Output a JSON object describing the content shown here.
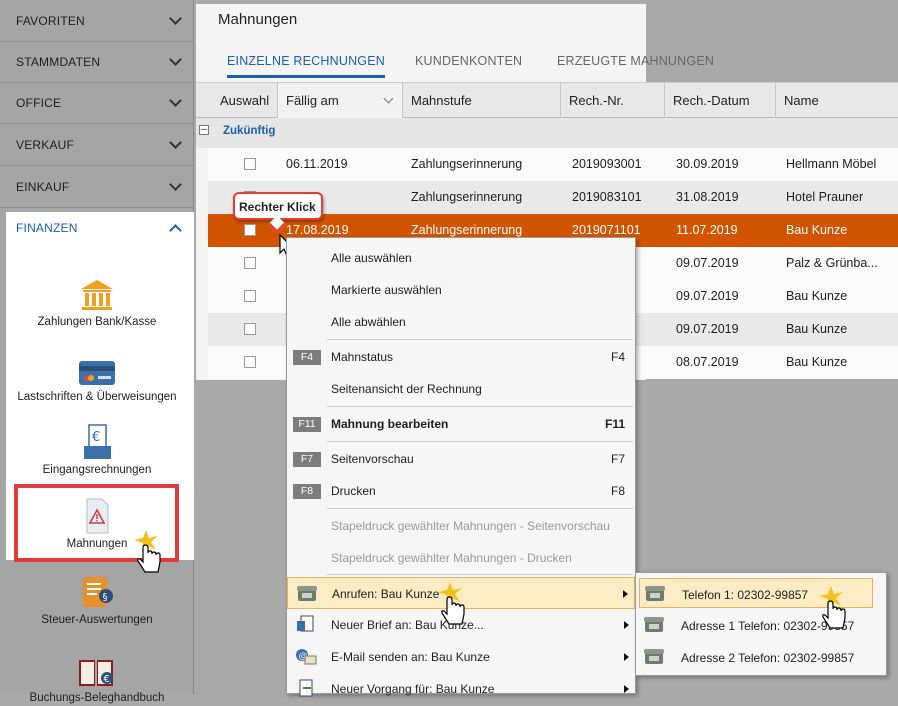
{
  "sidebar": {
    "sections": [
      "FAVORITEN",
      "STAMMDATEN",
      "OFFICE",
      "VERKAUF",
      "EINKAUF"
    ],
    "finance": {
      "title": "FINANZEN",
      "items": [
        {
          "label": "Zahlungen Bank/Kasse",
          "icon": "bank-icon"
        },
        {
          "label": "Lastschriften & Überweisungen",
          "icon": "card-icon"
        },
        {
          "label": "Eingangsrechnungen",
          "icon": "incoming-invoice-icon"
        },
        {
          "label": "Mahnungen",
          "icon": "reminder-document-icon"
        },
        {
          "label": "Steuer-Auswertungen",
          "icon": "tax-scroll-icon"
        },
        {
          "label": "Buchungs-Beleghandbuch",
          "icon": "book-icon"
        }
      ]
    }
  },
  "main": {
    "title": "Mahnungen",
    "tabs": [
      "EINZELNE RECHNUNGEN",
      "KUNDENKONTEN",
      "ERZEUGTE MAHNUNGEN"
    ],
    "columns": [
      "Auswahl",
      "Fällig am",
      "Mahnstufe",
      "Rech.-Nr.",
      "Rech.-Datum",
      "Name"
    ],
    "group": "Zukünftig",
    "rows": [
      {
        "due": "06.11.2019",
        "level": "Zahlungserinnerung",
        "nr": "2019093001",
        "date": "30.09.2019",
        "name": "Hellmann Möbel"
      },
      {
        "due": "19",
        "level": "Zahlungserinnerung",
        "nr": "2019083101",
        "date": "31.08.2019",
        "name": "Hotel Prauner"
      },
      {
        "due": "17.08.2019",
        "level": "Zahlungserinnerung",
        "nr": "2019071101",
        "date": "11.07.2019",
        "name": "Bau Kunze"
      },
      {
        "due": "",
        "level": "",
        "nr": "1",
        "date": "09.07.2019",
        "name": "Palz & Grünba..."
      },
      {
        "due": "",
        "level": "",
        "nr": "3",
        "date": "09.07.2019",
        "name": "Bau Kunze"
      },
      {
        "due": "",
        "level": "",
        "nr": "4",
        "date": "09.07.2019",
        "name": "Bau Kunze"
      },
      {
        "due": "",
        "level": "",
        "nr": "1",
        "date": "08.07.2019",
        "name": "Bau Kunze"
      }
    ]
  },
  "callout": "Rechter Klick",
  "context_menu": {
    "select_all": "Alle auswählen",
    "select_marked": "Markierte auswählen",
    "deselect_all": "Alle abwählen",
    "status": {
      "key": "F4",
      "label": "Mahnstatus",
      "shortcut": "F4"
    },
    "invoice_page": "Seitenansicht der Rechnung",
    "edit": {
      "key": "F11",
      "label": "Mahnung bearbeiten",
      "shortcut": "F11"
    },
    "preview": {
      "key": "F7",
      "label": "Seitenvorschau",
      "shortcut": "F7"
    },
    "print": {
      "key": "F8",
      "label": "Drucken",
      "shortcut": "F8"
    },
    "batch_preview": "Stapeldruck gewählter Mahnungen - Seitenvorschau",
    "batch_print": "Stapeldruck gewählter Mahnungen - Drucken",
    "call": "Anrufen: Bau Kunze",
    "letter": "Neuer Brief an: Bau Kunze...",
    "email": "E-Mail senden an: Bau Kunze",
    "process": "Neuer Vorgang für: Bau Kunze"
  },
  "submenu": [
    "Telefon 1: 02302-99857",
    "Adresse 1 Telefon: 02302-99857",
    "Adresse 2 Telefon: 02302-99857"
  ],
  "colors": {
    "accent": "#1a5fb4",
    "highlight_row": "#d35400",
    "highlight_red": "#e23b3b",
    "selected_menu": "#fdecc3"
  }
}
